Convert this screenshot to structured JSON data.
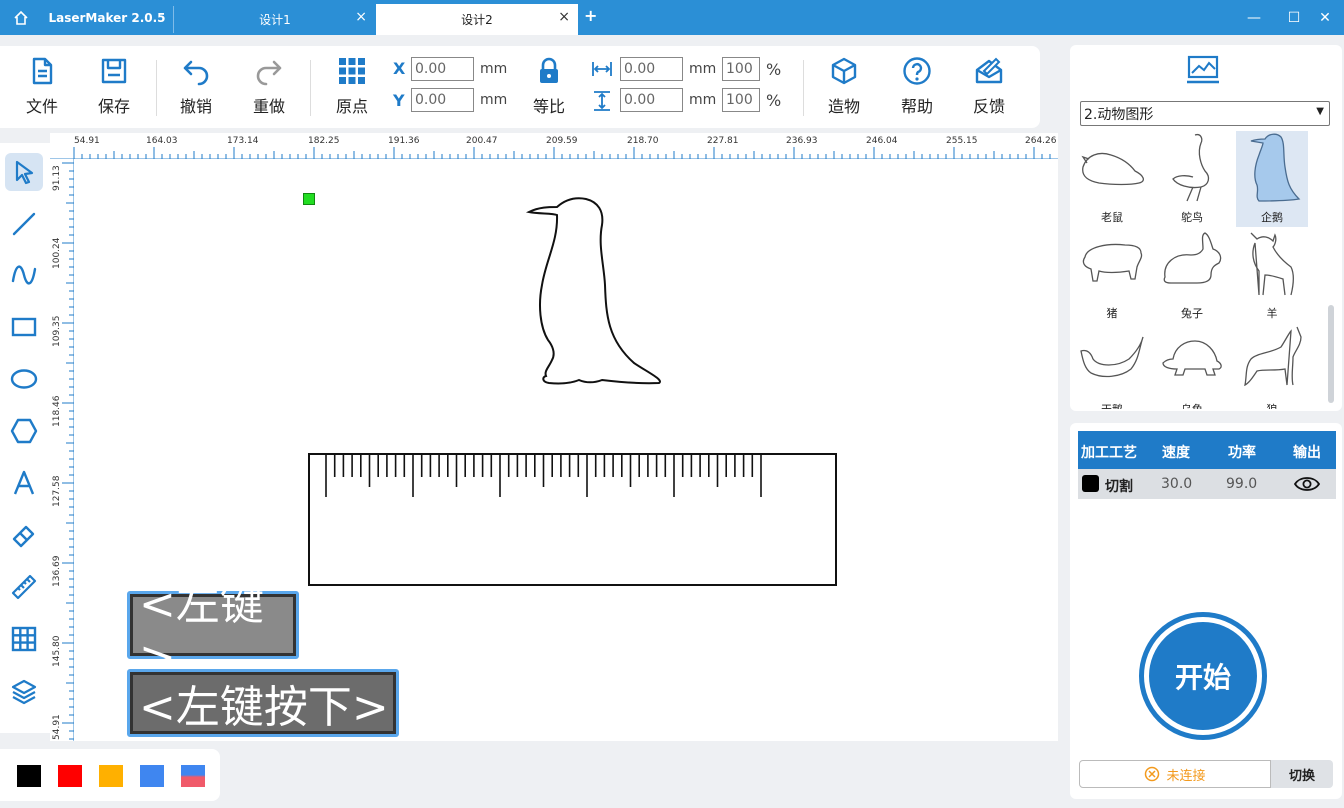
{
  "titlebar": {
    "app_name": "LaserMaker 2.0.5",
    "tabs": [
      {
        "label": "设计1",
        "close": "×"
      },
      {
        "label": "设计2",
        "close": "×"
      }
    ],
    "add_tab": "+",
    "minimize": "—",
    "maximize": "☐",
    "close": "✕",
    "bg_color": "#2b8fd6"
  },
  "toolbar": {
    "file": "文件",
    "save": "保存",
    "undo": "撤销",
    "redo": "重做",
    "origin": "原点",
    "x_label": "X",
    "y_label": "Y",
    "x_value": "0.00",
    "y_value": "0.00",
    "unit": "mm",
    "lock": "等比",
    "width_value": "0.00",
    "height_value": "0.00",
    "width_pct": "100",
    "height_pct": "100",
    "percent": "%",
    "build": "造物",
    "help": "帮助",
    "feedback": "反馈",
    "accent": "#1f7bc8"
  },
  "ruler": {
    "top_labels": [
      "54.91",
      "164.03",
      "173.14",
      "182.25",
      "191.36",
      "200.47",
      "209.59",
      "218.70",
      "227.81",
      "236.93",
      "246.04",
      "255.15",
      "264.26"
    ],
    "left_labels": [
      "91.13",
      "100.24",
      "109.35",
      "118.46",
      "127.58",
      "136.69",
      "145.80",
      "54.91"
    ]
  },
  "keys": {
    "left_click": "<左键>",
    "left_press": "<左键按下>"
  },
  "colors": [
    "#000000",
    "#ff0000",
    "#ffb000",
    "#3f86f0",
    "gradient"
  ],
  "library": {
    "category": "2.动物图形",
    "items": [
      {
        "name": "老鼠"
      },
      {
        "name": "鸵鸟"
      },
      {
        "name": "企鹅"
      },
      {
        "name": "猪"
      },
      {
        "name": "兔子"
      },
      {
        "name": "羊"
      },
      {
        "name": "天鹅"
      },
      {
        "name": "乌龟"
      },
      {
        "name": "狼"
      }
    ]
  },
  "process": {
    "headers": [
      "加工工艺",
      "速度",
      "功率",
      "输出"
    ],
    "row": {
      "name": "切割",
      "speed": "30.0",
      "power": "99.0",
      "color": "#000000"
    }
  },
  "start_button": "开始",
  "connection": {
    "status": "未连接",
    "switch": "切换"
  }
}
